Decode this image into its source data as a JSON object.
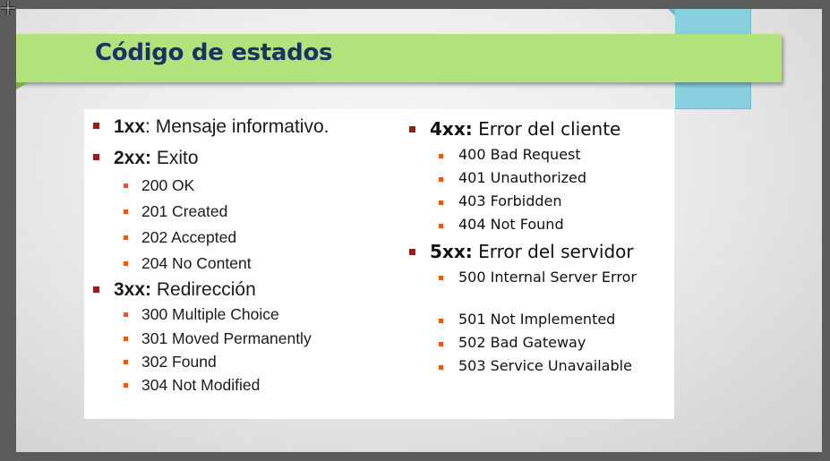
{
  "title": "Código de estados",
  "left_column": {
    "groups": [
      {
        "code": "1xx",
        "sep": ":",
        "label": " Mensaje informativo.",
        "items": []
      },
      {
        "code": "2xx:",
        "sep": "",
        "label": " Exito",
        "items": [
          "200 OK",
          "201 Created",
          "202 Accepted",
          "204 No Content"
        ]
      },
      {
        "code": "3xx:",
        "sep": "",
        "label": " Redirección",
        "items": [
          "300 Multiple Choice",
          "301 Moved Permanently",
          "302 Found",
          "304 Not Modified"
        ]
      }
    ]
  },
  "right_column": {
    "groups": [
      {
        "code": "4xx:",
        "label": " Error del cliente",
        "items": [
          "400 Bad Request",
          "401 Unauthorized",
          "403 Forbidden",
          "404 Not Found"
        ]
      },
      {
        "code": "5xx:",
        "label": " Error del servidor",
        "items": [
          "500 Internal Server Error",
          "501 Not Implemented",
          "502 Bad Gateway",
          "503 Service Unavailable"
        ]
      }
    ]
  },
  "colors": {
    "title_bar": "#b1e27b",
    "title_text": "#1e2f63",
    "accent_block": "#88cfdf",
    "bullet_level1": "#9b1b1b",
    "bullet_level2": "#e8561a"
  },
  "icons": {
    "cursor": "move-cursor-icon"
  }
}
